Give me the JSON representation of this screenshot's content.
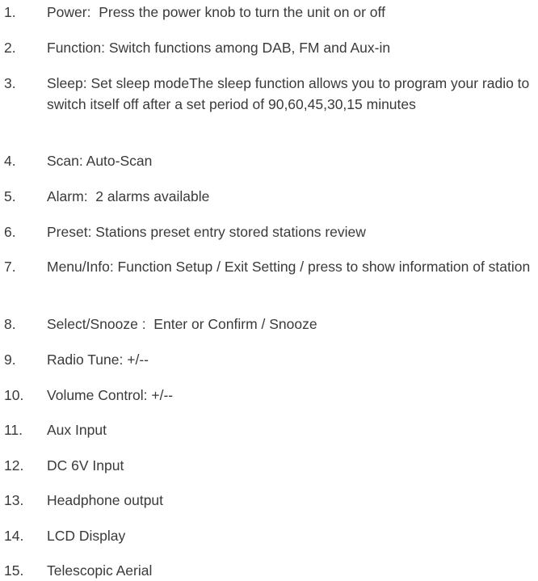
{
  "items": [
    {
      "num": "1.",
      "text": "Power:  Press the power knob to turn the unit on or off"
    },
    {
      "num": "2.",
      "text": "Function: Switch functions among DAB, FM and Aux-in"
    },
    {
      "num": "3.",
      "text": "Sleep: Set sleep modeThe sleep function allows you to program your radio to switch itself off after a set period of 90,60,45,30,15 minutes"
    },
    {
      "num": "4.",
      "text": "Scan: Auto-Scan"
    },
    {
      "num": "5.",
      "text": "Alarm:  2 alarms available"
    },
    {
      "num": "6.",
      "text": "Preset: Stations preset entry stored stations review"
    },
    {
      "num": "7.",
      "text": "Menu/Info: Function Setup / Exit Setting / press to show information of station"
    },
    {
      "num": "8.",
      "text": "Select/Snooze :  Enter or Confirm / Snooze"
    },
    {
      "num": "9.",
      "text": "Radio Tune: +/--"
    },
    {
      "num": "10.",
      "text": "Volume Control: +/--"
    },
    {
      "num": "11.",
      "text": "Aux Input"
    },
    {
      "num": "12.",
      "text": "DC 6V Input"
    },
    {
      "num": "13.",
      "text": "Headphone output"
    },
    {
      "num": "14.",
      "text": "LCD Display"
    },
    {
      "num": "15.",
      "text": "Telescopic Aerial"
    }
  ]
}
